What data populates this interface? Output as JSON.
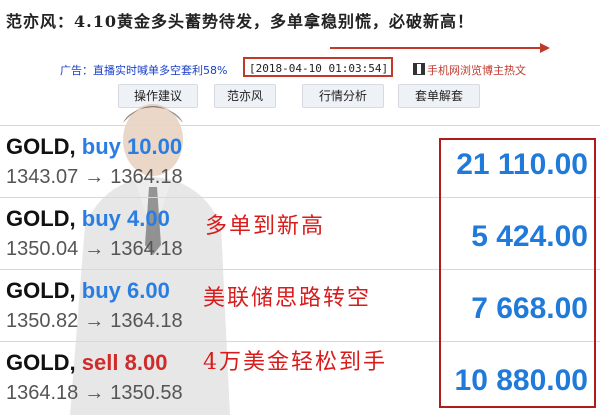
{
  "headline": "范亦风：4.10黄金多头蓄势待发，多单拿稳别慌，必破新高！",
  "adbar": {
    "left_text": "广告：直播实时喊单多空套利58%",
    "timestamp": "[2018-04-10 01:03:54]",
    "right_text": "手机网浏览博主热文",
    "right_icon": "qr-code-icon"
  },
  "tabs": [
    "操作建议",
    "范亦风",
    "行情分析",
    "套单解套"
  ],
  "trades": [
    {
      "symbol": "GOLD,",
      "action": "buy 10.00",
      "side": "buy",
      "open": "1343.07",
      "close": "1364.18",
      "profit": "21 110.00"
    },
    {
      "symbol": "GOLD,",
      "action": "buy 4.00",
      "side": "buy",
      "open": "1350.04",
      "close": "1364.18",
      "profit": "5 424.00"
    },
    {
      "symbol": "GOLD,",
      "action": "buy 6.00",
      "side": "buy",
      "open": "1350.82",
      "close": "1364.18",
      "profit": "7 668.00"
    },
    {
      "symbol": "GOLD,",
      "action": "sell 8.00",
      "side": "sell",
      "open": "1364.18",
      "close": "1350.58",
      "profit": "10 880.00"
    }
  ],
  "arrow_glyph": "→",
  "slogans": [
    "多单到新高",
    "美联储思路转空",
    "4万美金轻松到手"
  ],
  "colors": {
    "buy": "#2a7de1",
    "sell": "#d02a2a",
    "profit": "#1f7ad9",
    "highlight_border": "#b01c1c",
    "slogan": "#d81c1c"
  }
}
